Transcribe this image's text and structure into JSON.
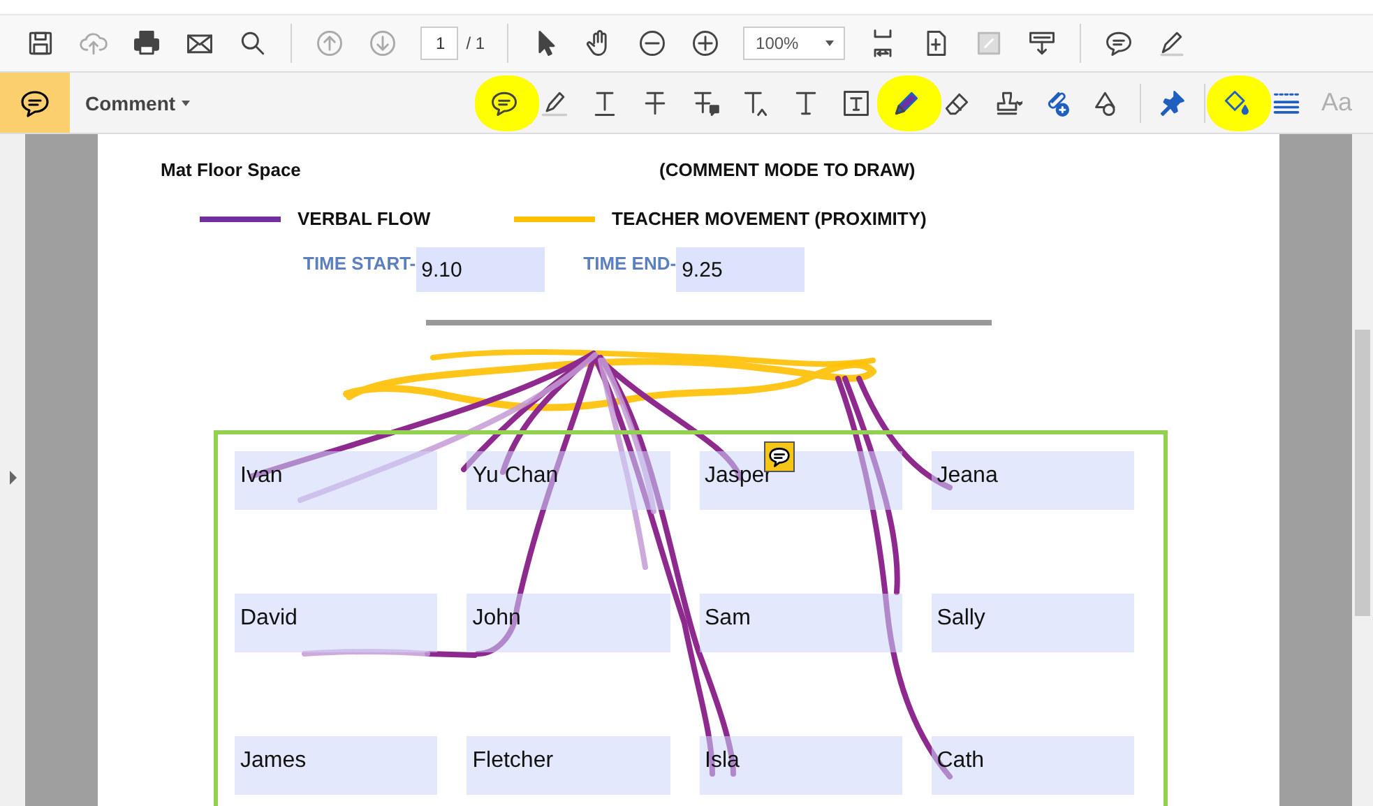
{
  "toolbar": {
    "items": [
      {
        "kind": "save"
      },
      {
        "kind": "upload"
      },
      {
        "kind": "print"
      },
      {
        "kind": "mail"
      },
      {
        "kind": "search"
      },
      {
        "kind": "sep"
      },
      {
        "kind": "prev-page"
      },
      {
        "kind": "next-page"
      },
      {
        "kind": "page-field",
        "value": "1",
        "total": "/ 1"
      },
      {
        "kind": "sep"
      },
      {
        "kind": "pointer"
      },
      {
        "kind": "hand"
      },
      {
        "kind": "zoom-out"
      },
      {
        "kind": "zoom-in"
      },
      {
        "kind": "zoom-field",
        "value": "100%"
      },
      {
        "kind": "fit-page"
      },
      {
        "kind": "fit-width"
      },
      {
        "kind": "fullscreen"
      },
      {
        "kind": "read-mode"
      },
      {
        "kind": "sep"
      },
      {
        "kind": "comment"
      },
      {
        "kind": "sign"
      }
    ]
  },
  "comment_bar": {
    "label": "Comment",
    "tools": [
      {
        "kind": "sticky-note",
        "circled": true
      },
      {
        "kind": "highlight",
        "circled": false
      },
      {
        "kind": "underline",
        "circled": false
      },
      {
        "kind": "strike",
        "circled": false
      },
      {
        "kind": "text-comment",
        "circled": false
      },
      {
        "kind": "insert-text",
        "circled": false
      },
      {
        "kind": "add-text",
        "circled": false
      },
      {
        "kind": "text-box",
        "circled": false
      },
      {
        "kind": "pencil",
        "circled": true
      },
      {
        "kind": "eraser",
        "circled": false
      },
      {
        "kind": "stamp",
        "circled": false
      },
      {
        "kind": "attach",
        "circled": false
      },
      {
        "kind": "shapes",
        "circled": false
      },
      {
        "kind": "sep",
        "circled": false
      },
      {
        "kind": "pin",
        "circled": false
      },
      {
        "kind": "sep",
        "circled": false
      },
      {
        "kind": "fill",
        "circled": true
      },
      {
        "kind": "line-style",
        "circled": false
      },
      {
        "kind": "font",
        "text": "Aa",
        "circled": false
      }
    ]
  },
  "document": {
    "title": "Mat Floor Space",
    "note": "(COMMENT MODE TO DRAW)",
    "legend": [
      {
        "label": "VERBAL FLOW",
        "color": "#7030a0"
      },
      {
        "label": "TEACHER MOVEMENT (PROXIMITY)",
        "color": "#ffc000"
      }
    ],
    "time_start": {
      "label": "TIME START-",
      "value": "9.10"
    },
    "time_end": {
      "label": "TIME END-",
      "value": "9.25"
    },
    "students": [
      [
        {
          "name": "Ivan"
        },
        {
          "name": "Yu Chan"
        },
        {
          "name": "Jasper"
        },
        {
          "name": "Jeana"
        }
      ],
      [
        {
          "name": "David"
        },
        {
          "name": "John"
        },
        {
          "name": "Sam"
        },
        {
          "name": "Sally"
        }
      ],
      [
        {
          "name": "James"
        },
        {
          "name": "Fletcher"
        },
        {
          "name": "Isla"
        },
        {
          "name": "Cath"
        }
      ]
    ]
  }
}
